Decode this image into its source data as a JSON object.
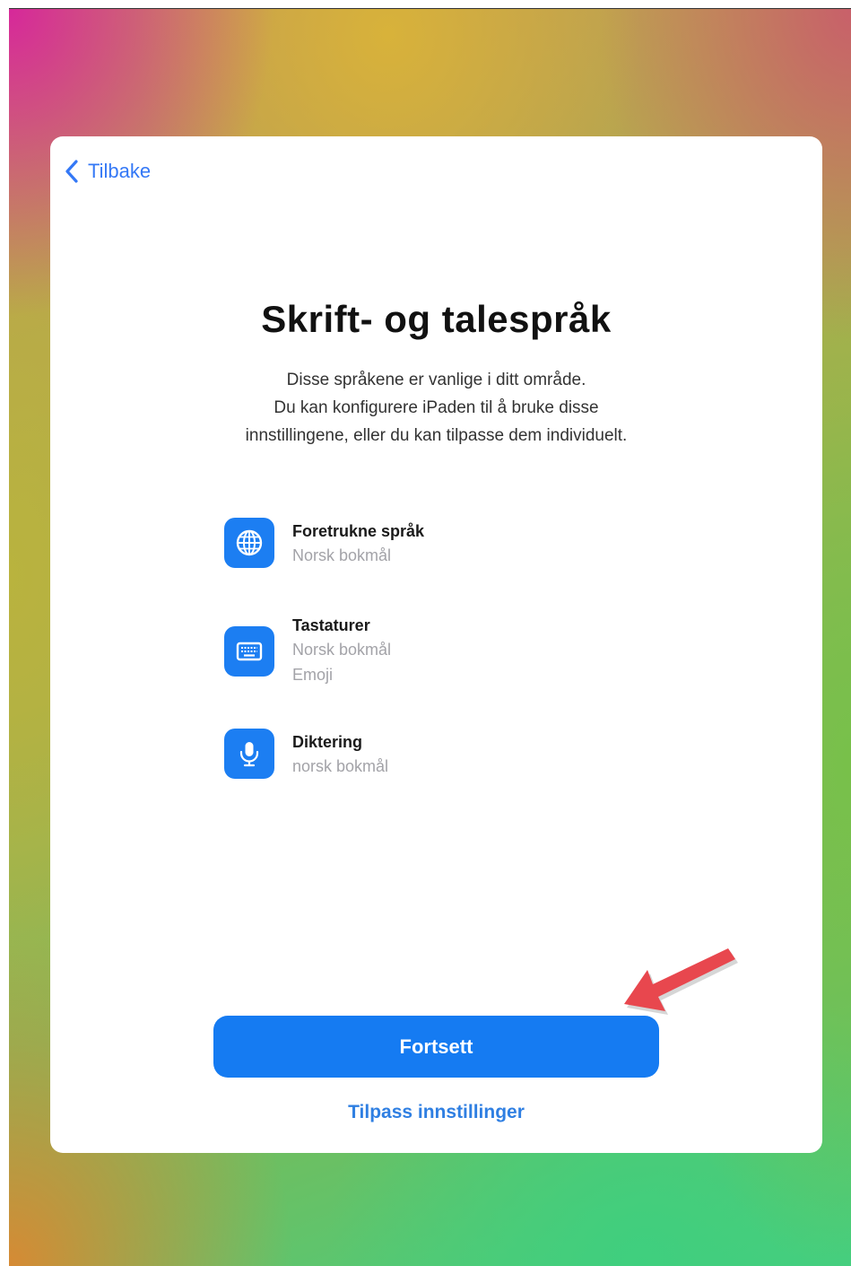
{
  "colors": {
    "accent": "#157bf2",
    "link": "#3478f6",
    "icon_background": "#1c7ef2",
    "annotation_arrow": "#e8474e"
  },
  "nav": {
    "back_label": "Tilbake",
    "back_icon": "chevron-left-icon"
  },
  "page": {
    "title": "Skrift- og talespråk",
    "description_lines": [
      "Disse språkene er vanlige i ditt område.",
      "Du kan konfigurere iPaden til å bruke disse",
      "innstillingene, eller du kan tilpasse dem individuelt."
    ]
  },
  "items": [
    {
      "icon": "globe-icon",
      "title": "Foretrukne språk",
      "values": [
        "Norsk bokmål"
      ]
    },
    {
      "icon": "keyboard-icon",
      "title": "Tastaturer",
      "values": [
        "Norsk bokmål",
        "Emoji"
      ]
    },
    {
      "icon": "microphone-icon",
      "title": "Diktering",
      "values": [
        "norsk bokmål"
      ]
    }
  ],
  "actions": {
    "continue_label": "Fortsett",
    "customize_label": "Tilpass innstillinger"
  },
  "annotation": {
    "icon": "red-arrow-icon"
  }
}
